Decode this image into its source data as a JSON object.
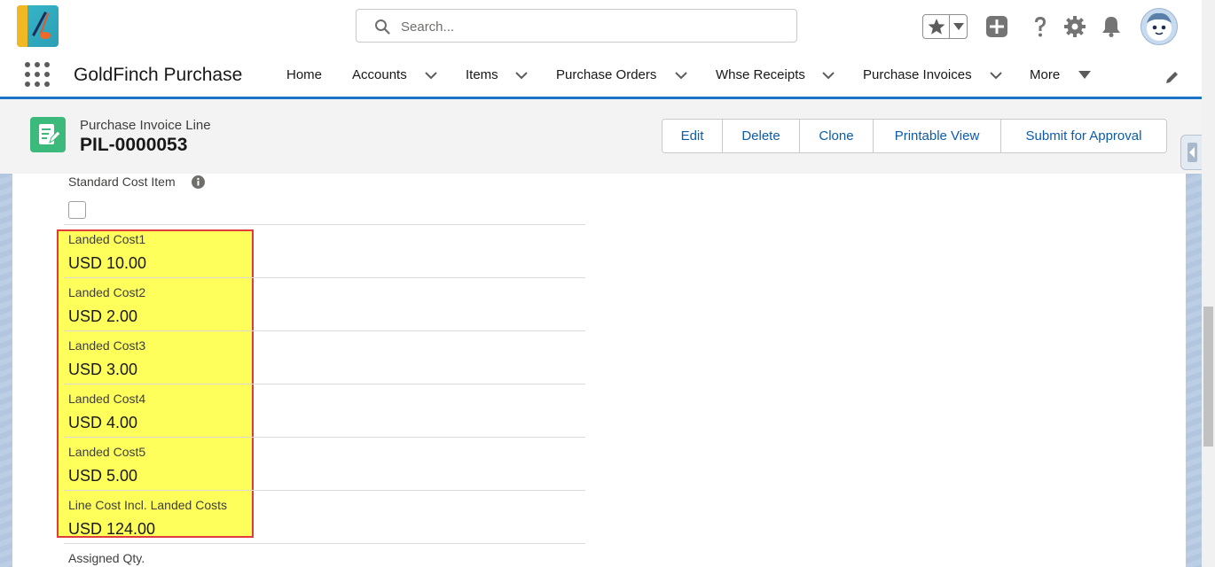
{
  "header": {
    "search_placeholder": "Search...",
    "icons": [
      "favorites-star-icon",
      "global-actions-plus-icon",
      "help-icon",
      "setup-gear-icon",
      "notifications-bell-icon",
      "user-avatar"
    ]
  },
  "nav": {
    "app_name": "GoldFinch Purchase",
    "items": [
      {
        "label": "Home",
        "has_menu": false
      },
      {
        "label": "Accounts",
        "has_menu": true
      },
      {
        "label": "Items",
        "has_menu": true
      },
      {
        "label": "Purchase Orders",
        "has_menu": true
      },
      {
        "label": "Whse Receipts",
        "has_menu": true
      },
      {
        "label": "Purchase Invoices",
        "has_menu": true
      },
      {
        "label": "More",
        "has_menu": true
      }
    ]
  },
  "record": {
    "object_type": "Purchase Invoice Line",
    "name": "PIL-0000053",
    "actions": [
      "Edit",
      "Delete",
      "Clone",
      "Printable View",
      "Submit for Approval"
    ]
  },
  "fields": {
    "standard_cost_item": {
      "label": "Standard Cost Item",
      "checked": false
    },
    "landed_cost1": {
      "label": "Landed Cost1",
      "value": "USD 10.00"
    },
    "landed_cost2": {
      "label": "Landed Cost2",
      "value": "USD 2.00"
    },
    "landed_cost3": {
      "label": "Landed Cost3",
      "value": "USD 3.00"
    },
    "landed_cost4": {
      "label": "Landed Cost4",
      "value": "USD 4.00"
    },
    "landed_cost5": {
      "label": "Landed Cost5",
      "value": "USD 5.00"
    },
    "line_cost_incl_landed": {
      "label": "Line Cost Incl. Landed Costs",
      "value": "USD 124.00"
    },
    "assigned_qty": {
      "label": "Assigned Qty."
    }
  },
  "colors": {
    "brand_blue": "#1b74c7",
    "link_blue": "#0b5cab",
    "highlight_fill": "#ffff5c",
    "highlight_border": "#e23b3b",
    "object_icon": "#3bba7c"
  }
}
